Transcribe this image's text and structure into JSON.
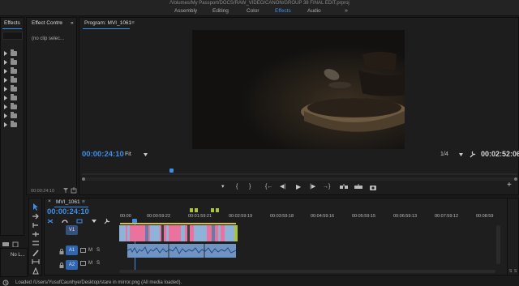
{
  "window": {
    "title": "/Volumes/My Passport/DOCS/RAW_VIDEO/CANON/GROUP 38 FINAL EDIT.prproj"
  },
  "workspaces": {
    "items": [
      "Assembly",
      "Editing",
      "Color",
      "Effects",
      "Audio"
    ],
    "active": "Effects",
    "more": "»"
  },
  "effects_panel": {
    "tab_label": "Effects",
    "more": "»",
    "folder_count": 9
  },
  "effect_controls": {
    "tab_label": "Effect Contro",
    "menu": "≡",
    "more": "»",
    "no_clip_text": "(no clip selec...",
    "timecode": "00:00:24:10"
  },
  "program_monitor": {
    "tab_label": "Program: MVI_1061",
    "menu": "≡",
    "timecode": "00:00:24:10",
    "fit_label": "Fit",
    "resolution": "1/4",
    "duration": "00:02:52:06",
    "playhead_fraction": 0.205
  },
  "transport": {
    "marker": "▾",
    "in": "{",
    "out": "}",
    "go_in": "{←",
    "step_back": "◀|",
    "play": "▶",
    "step_forward": "|▶",
    "go_out": "→}",
    "add": "+"
  },
  "timeline": {
    "sequence_name": "MVI_1061",
    "menu": "≡",
    "close": "×",
    "timecode": "00:00:24:10",
    "ruler": [
      "00:00",
      "00:00:59:22",
      "00:01:59:21",
      "00:02:59:19",
      "00:03:59:18",
      "00:04:59:16",
      "00:05:59:15",
      "00:06:59:13",
      "00:07:59:12",
      "00:08:59"
    ],
    "tracks": [
      {
        "target": "V1",
        "name": "V1"
      },
      {
        "target": "A1",
        "name": "A1",
        "m": "M",
        "s": "S"
      },
      {
        "target": "A2",
        "name": "A2",
        "m": "M",
        "s": "S"
      }
    ],
    "meter_labels": [
      "S",
      "S"
    ]
  },
  "bottom_left": {
    "text": "No L..."
  },
  "status_bar": {
    "text": "Loaded /Users/YusufCaunhye/Desktop/stare in mirror.png (All media loaded)."
  },
  "colors": {
    "accent": "#3d8ee8",
    "clip_video": "#e9739c",
    "clip_audio": "#6f94c4",
    "marker": "#a7c43a"
  }
}
